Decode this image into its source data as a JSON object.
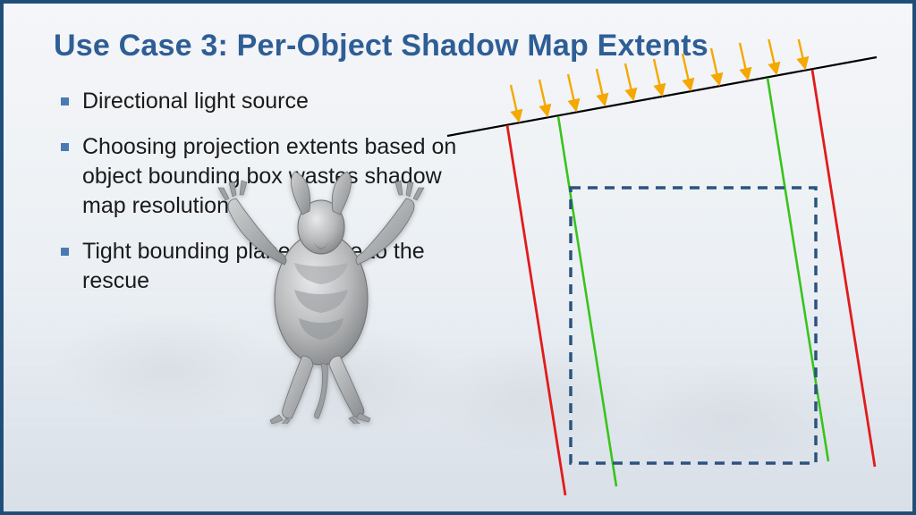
{
  "title": "Use Case 3: Per-Object Shadow Map Extents",
  "bullets": {
    "0": "Directional light source",
    "1": "Choosing projection extents based on object bounding box wastes shadow map resolution",
    "2": "Tight bounding planes come to the rescue"
  },
  "colors": {
    "accent": "#2e5e95",
    "bullet": "#4a7ab4",
    "light_arrow": "#f5a800",
    "bbox_extent": "#e21b1b",
    "tight_extent": "#39c41c",
    "bbox_dash": "#2b547e"
  }
}
